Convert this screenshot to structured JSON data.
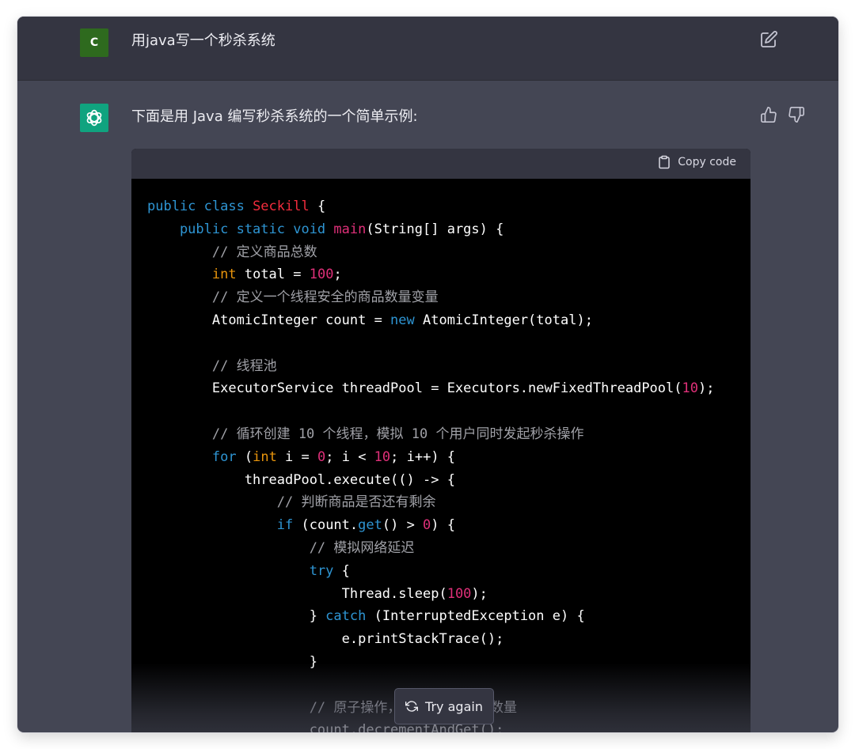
{
  "user": {
    "avatar_letter": "C",
    "message": "用java写一个秒杀系统"
  },
  "assistant": {
    "intro": "下面是用 Java 编写秒杀系统的一个简单示例:"
  },
  "code": {
    "copy_label": "Copy code",
    "lines": [
      [
        {
          "t": "public class ",
          "c": "kw"
        },
        {
          "t": "Seckill",
          "c": "cls"
        },
        {
          "t": " {",
          "c": ""
        }
      ],
      [
        {
          "t": "    public static void ",
          "c": "kw"
        },
        {
          "t": "main",
          "c": "fn"
        },
        {
          "t": "(String[] args) {",
          "c": ""
        }
      ],
      [
        {
          "t": "        // 定义商品总数",
          "c": "cm"
        }
      ],
      [
        {
          "t": "        ",
          "c": ""
        },
        {
          "t": "int",
          "c": "typ"
        },
        {
          "t": " total = ",
          "c": ""
        },
        {
          "t": "100",
          "c": "num"
        },
        {
          "t": ";",
          "c": ""
        }
      ],
      [
        {
          "t": "        // 定义一个线程安全的商品数量变量",
          "c": "cm"
        }
      ],
      [
        {
          "t": "        AtomicInteger count = ",
          "c": ""
        },
        {
          "t": "new",
          "c": "kw"
        },
        {
          "t": " AtomicInteger(total);",
          "c": ""
        }
      ],
      [
        {
          "t": "",
          "c": ""
        }
      ],
      [
        {
          "t": "        // 线程池",
          "c": "cm"
        }
      ],
      [
        {
          "t": "        ExecutorService threadPool = Executors.newFixedThreadPool(",
          "c": ""
        },
        {
          "t": "10",
          "c": "num"
        },
        {
          "t": ");",
          "c": ""
        }
      ],
      [
        {
          "t": "",
          "c": ""
        }
      ],
      [
        {
          "t": "        // 循环创建 10 个线程，模拟 10 个用户同时发起秒杀操作",
          "c": "cm"
        }
      ],
      [
        {
          "t": "        ",
          "c": ""
        },
        {
          "t": "for",
          "c": "kw"
        },
        {
          "t": " (",
          "c": ""
        },
        {
          "t": "int",
          "c": "typ"
        },
        {
          "t": " i = ",
          "c": ""
        },
        {
          "t": "0",
          "c": "num"
        },
        {
          "t": "; i < ",
          "c": ""
        },
        {
          "t": "10",
          "c": "num"
        },
        {
          "t": "; i++) {",
          "c": ""
        }
      ],
      [
        {
          "t": "            threadPool.execute(() -> {",
          "c": ""
        }
      ],
      [
        {
          "t": "                // 判断商品是否还有剩余",
          "c": "cm"
        }
      ],
      [
        {
          "t": "                ",
          "c": ""
        },
        {
          "t": "if",
          "c": "kw"
        },
        {
          "t": " (count.",
          "c": ""
        },
        {
          "t": "get",
          "c": "kw"
        },
        {
          "t": "() > ",
          "c": ""
        },
        {
          "t": "0",
          "c": "num"
        },
        {
          "t": ") {",
          "c": ""
        }
      ],
      [
        {
          "t": "                    // 模拟网络延迟",
          "c": "cm"
        }
      ],
      [
        {
          "t": "                    ",
          "c": ""
        },
        {
          "t": "try",
          "c": "kw"
        },
        {
          "t": " {",
          "c": ""
        }
      ],
      [
        {
          "t": "                        Thread.sleep(",
          "c": ""
        },
        {
          "t": "100",
          "c": "num"
        },
        {
          "t": ");",
          "c": ""
        }
      ],
      [
        {
          "t": "                    } ",
          "c": ""
        },
        {
          "t": "catch",
          "c": "kw"
        },
        {
          "t": " (InterruptedException e) {",
          "c": ""
        }
      ],
      [
        {
          "t": "                        e.printStackTrace();",
          "c": ""
        }
      ],
      [
        {
          "t": "                    }",
          "c": ""
        }
      ],
      [
        {
          "t": "",
          "c": ""
        }
      ],
      [
        {
          "t": "                    // 原子操作，",
          "c": "cm"
        },
        {
          "t": "           ",
          "c": ""
        },
        {
          "t": "数量",
          "c": "cm"
        }
      ],
      [
        {
          "t": "                    count.decrementAndGet();",
          "c": ""
        }
      ]
    ]
  },
  "try_again": {
    "label": "Try again"
  },
  "colors": {
    "user_bg": "#343541",
    "assistant_bg": "#444654",
    "code_bg": "#000000",
    "keyword": "#2e95d3",
    "class_name": "#f22c3d",
    "number": "#df3079",
    "type": "#e9950c",
    "comment": "#a0a1a7",
    "user_avatar": "#2e6a1e",
    "ai_avatar": "#10a37f"
  },
  "icons": {
    "edit": "edit-icon",
    "thumb_up": "thumb-up-icon",
    "thumb_down": "thumb-down-icon",
    "clipboard": "clipboard-icon",
    "refresh": "refresh-icon",
    "logo": "openai-logo-icon"
  }
}
